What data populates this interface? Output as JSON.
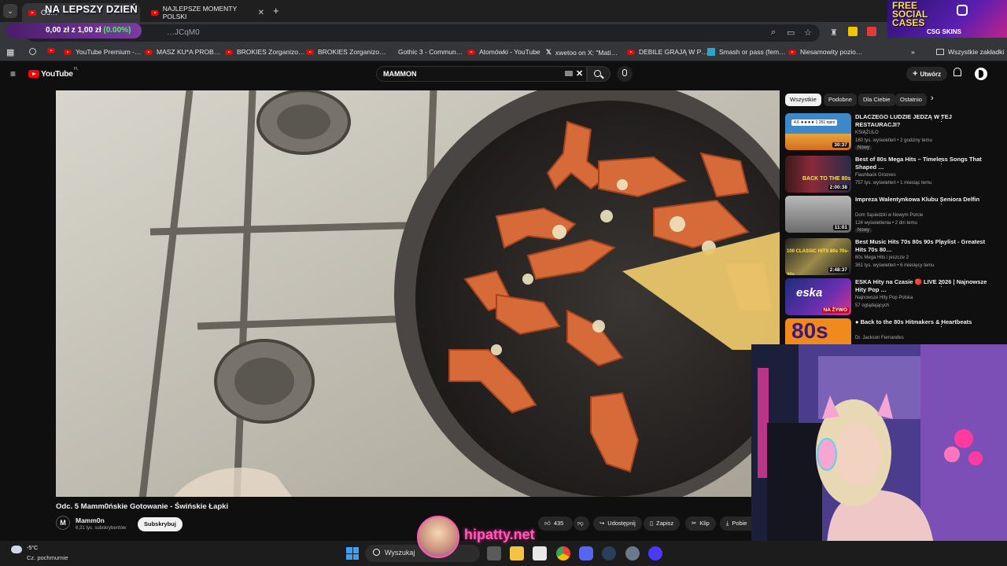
{
  "browser": {
    "tabs": [
      {
        "label": "Od…",
        "active": true
      },
      {
        "label": "NAJLEPSZE MOMENTY POLSKI",
        "active": false
      }
    ],
    "url": "…JCqM0",
    "bookmarks": [
      "YouTube Premium -…",
      "MASZ KU*A PROB…",
      "BROKIES Zorganizo…",
      "BROKIES Zorganizo…",
      "Gothic 3 - Commun…",
      "Atomówki - YouTube",
      "xwetoo on X: \"Mati…",
      "DEBILE GRAJĄ W P…",
      "Smash or pass (fem…",
      "Niesamowity pozio…"
    ],
    "all_bookmarks": "Wszystkie zakładki"
  },
  "overlay": {
    "stream_title": "NA LEPSZY DZIEŃ",
    "price_text": "0,00 zł z 1,00 zł",
    "price_pct": "(0.00%)",
    "promo_line1": "FREE",
    "promo_line2": "SOCIAL",
    "promo_line3": "CASES",
    "promo_brand": "CSG SKINS",
    "watermark": "hipatty.net"
  },
  "youtube": {
    "logo": "YouTube",
    "logo_region": "PL",
    "search_query": "MAMMON",
    "create_label": "Utwórz",
    "filter_chips": [
      "Wszystkie",
      "Podobne",
      "Dla Ciebie",
      "Ostatnio"
    ],
    "video": {
      "title": "Odc. 5 Mamm0ńskie Gotowanie - Świńskie Łapki",
      "channel": "Mamm0n",
      "subscribers": "6,31 tys. subskrybentów",
      "subscribe_label": "Subskrybuj",
      "likes": "435",
      "share_label": "Udostępnij",
      "save_label": "Zapisz",
      "clip_label": "Klip",
      "download_label": "Pobie"
    },
    "recommendations": [
      {
        "title": "DLACZEGO LUDZIE JEDZĄ W TEJ RESTAURACJI?",
        "channel": "KSIĄŻULO",
        "meta": "160 tys. wyświetleń • 2 godziny temu",
        "badge": "Nowy",
        "duration": "30:37",
        "thumb_text": "4.6 ★★★★ 1 251 opini"
      },
      {
        "title": "Best of 80s Mega Hits – Timeless Songs That Shaped …",
        "channel": "Flashback Grooves",
        "meta": "757 tys. wyświetleń • 1 miesiąc temu",
        "badge": "",
        "duration": "2:00:38",
        "thumb_text": "BACK TO THE 80s"
      },
      {
        "title": "Impreza Walentynkowa Klubu Seniora Delfin",
        "channel": "Dom Sąsiedzki w Nowym Porcie",
        "meta": "124 wyświetlenia • 2 dni temu",
        "badge": "Nowy",
        "duration": "11:01",
        "thumb_text": ""
      },
      {
        "title": "Best Music Hits 70s 80s 90s Playlist - Greatest Hits 70s 80…",
        "channel": "80s Mega Hits i jeszcze 2",
        "meta": "361 tys. wyświetleń • 6 miesięcy temu",
        "badge": "",
        "duration": "2:48:37",
        "thumb_text": "100 CLASSIC HITS 80s 70s-80s"
      },
      {
        "title": "ESKA Hity na Czasie 🔴 LIVE 2026 | Najnowsze Hity Pop …",
        "channel": "Najnowsze Hity Pop Polska",
        "meta": "57 oglądających",
        "badge": "",
        "duration": "NA ŻYWO",
        "thumb_text": "eska"
      },
      {
        "title": "● Back to the 80s  Hitmakers & Heartbeats",
        "channel": "Dr. Jackson Fernandes",
        "meta": "",
        "badge": "",
        "duration": "",
        "thumb_text": "80s"
      }
    ]
  },
  "taskbar": {
    "weather_temp": "-5°C",
    "weather_desc": "Cz. pochmurnie",
    "search_label": "Wyszukaj"
  },
  "colors": {
    "youtube_red": "#ff0000",
    "price_green": "#3dff5a",
    "watermark_pink": "#ff5ab8"
  }
}
